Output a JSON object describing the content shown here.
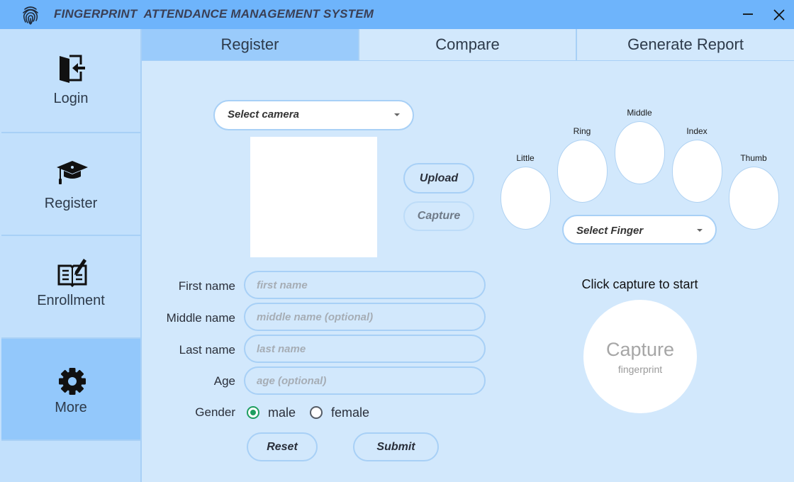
{
  "window": {
    "title": "FINGERPRINT  ATTENDANCE MANAGEMENT SYSTEM",
    "logo_icon": "fingerprint-icon",
    "minimize_icon": "minimize-icon",
    "close_icon": "close-icon"
  },
  "sidebar": {
    "items": [
      {
        "label": "Login",
        "icon": "login-door-icon",
        "active": false
      },
      {
        "label": "Register",
        "icon": "graduation-cap-icon",
        "active": false
      },
      {
        "label": "Enrollment",
        "icon": "book-pencil-icon",
        "active": false
      },
      {
        "label": "More",
        "icon": "gear-icon",
        "active": true
      }
    ]
  },
  "tabs": [
    {
      "label": "Register",
      "active": true
    },
    {
      "label": "Compare",
      "active": false
    },
    {
      "label": "Generate Report",
      "active": false
    }
  ],
  "register": {
    "camera_select": {
      "value": "Select camera"
    },
    "upload_label": "Upload",
    "capture_label": "Capture",
    "fingers": [
      "Little",
      "Ring",
      "Middle",
      "Index",
      "Thumb"
    ],
    "finger_select": {
      "value": "Select Finger"
    },
    "form": {
      "first_name": {
        "label": "First name",
        "placeholder": "first name",
        "value": ""
      },
      "middle_name": {
        "label": "Middle name",
        "placeholder": "middle name (optional)",
        "value": ""
      },
      "last_name": {
        "label": "Last name",
        "placeholder": "last name",
        "value": ""
      },
      "age": {
        "label": "Age",
        "placeholder": "age (optional)",
        "value": ""
      },
      "gender": {
        "label": "Gender",
        "options": [
          "male",
          "female"
        ],
        "selected": "male"
      }
    },
    "reset_label": "Reset",
    "submit_label": "Submit",
    "capture_hint": "Click capture to start",
    "capture_circle": {
      "title": "Capture",
      "subtitle": "fingerprint"
    }
  },
  "colors": {
    "titlebar": "#6eb4fb",
    "sidebar": "#c2e0fc",
    "sidebar_active": "#93c8fb",
    "content_bg": "#d2e8fc",
    "tab_active": "#9acbfb",
    "border": "#a8d0f6",
    "radio_selected": "#1f9e60"
  }
}
